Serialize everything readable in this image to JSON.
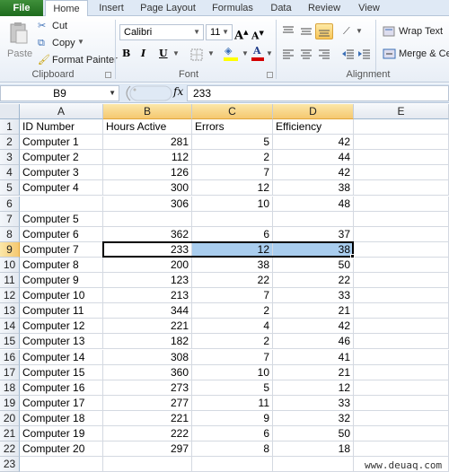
{
  "ribbon": {
    "tabs": [
      "File",
      "Home",
      "Insert",
      "Page Layout",
      "Formulas",
      "Data",
      "Review",
      "View"
    ],
    "active_tab": "Home",
    "clipboard": {
      "paste_label": "Paste",
      "cut_label": "Cut",
      "copy_label": "Copy",
      "format_painter_label": "Format Painter",
      "group_label": "Clipboard"
    },
    "font": {
      "font_name": "Calibri",
      "font_size": "11",
      "bold": "B",
      "italic": "I",
      "underline": "U",
      "group_label": "Font",
      "fill_color": "#ffff00",
      "font_color": "#d40000"
    },
    "alignment": {
      "wrap_text_label": "Wrap Text",
      "merge_label": "Merge & Cen",
      "group_label": "Alignment"
    }
  },
  "formula_bar": {
    "name_box": "B9",
    "fx_label": "fx",
    "value": "233"
  },
  "sheet": {
    "columns": [
      "A",
      "B",
      "C",
      "D",
      "E"
    ],
    "selected_columns": [
      "B",
      "C",
      "D"
    ],
    "selected_row": 9,
    "active_cell": "B9",
    "rows": [
      {
        "n": "1",
        "a": "ID Number",
        "b": "Hours Active",
        "c": "Errors",
        "d": "Efficiency",
        "header": true
      },
      {
        "n": "2",
        "a": "Computer 1",
        "b": "281",
        "c": "5",
        "d": "42"
      },
      {
        "n": "3",
        "a": "Computer 2",
        "b": "112",
        "c": "2",
        "d": "44"
      },
      {
        "n": "4",
        "a": "Computer 3",
        "b": "126",
        "c": "7",
        "d": "42"
      },
      {
        "n": "5",
        "a": "Computer 4",
        "b": "300",
        "c": "12",
        "d": "38"
      },
      {
        "n": "6",
        "a": "",
        "b": "306",
        "c": "10",
        "d": "48"
      },
      {
        "n": "7",
        "a": "Computer 5",
        "b": "",
        "c": "",
        "d": ""
      },
      {
        "n": "8",
        "a": "Computer 6",
        "b": "362",
        "c": "6",
        "d": "37"
      },
      {
        "n": "9",
        "a": "Computer 7",
        "b": "233",
        "c": "12",
        "d": "38"
      },
      {
        "n": "10",
        "a": "Computer 8",
        "b": "200",
        "c": "38",
        "d": "50"
      },
      {
        "n": "11",
        "a": "Computer 9",
        "b": "123",
        "c": "22",
        "d": "22"
      },
      {
        "n": "12",
        "a": "Computer 10",
        "b": "213",
        "c": "7",
        "d": "33"
      },
      {
        "n": "13",
        "a": "Computer 11",
        "b": "344",
        "c": "2",
        "d": "21"
      },
      {
        "n": "14",
        "a": "Computer 12",
        "b": "221",
        "c": "4",
        "d": "42"
      },
      {
        "n": "15",
        "a": "Computer 13",
        "b": "182",
        "c": "2",
        "d": "46"
      },
      {
        "n": "16",
        "a": "Computer 14",
        "b": "308",
        "c": "7",
        "d": "41"
      },
      {
        "n": "17",
        "a": "Computer 15",
        "b": "360",
        "c": "10",
        "d": "21"
      },
      {
        "n": "18",
        "a": "Computer 16",
        "b": "273",
        "c": "5",
        "d": "12"
      },
      {
        "n": "19",
        "a": "Computer 17",
        "b": "277",
        "c": "11",
        "d": "33"
      },
      {
        "n": "20",
        "a": "Computer 18",
        "b": "221",
        "c": "9",
        "d": "32"
      },
      {
        "n": "21",
        "a": "Computer 19",
        "b": "222",
        "c": "6",
        "d": "50"
      },
      {
        "n": "22",
        "a": "Computer 20",
        "b": "297",
        "c": "8",
        "d": "18"
      },
      {
        "n": "23",
        "a": "",
        "b": "",
        "c": "",
        "d": ""
      }
    ]
  },
  "watermark": "www.deuaq.com"
}
